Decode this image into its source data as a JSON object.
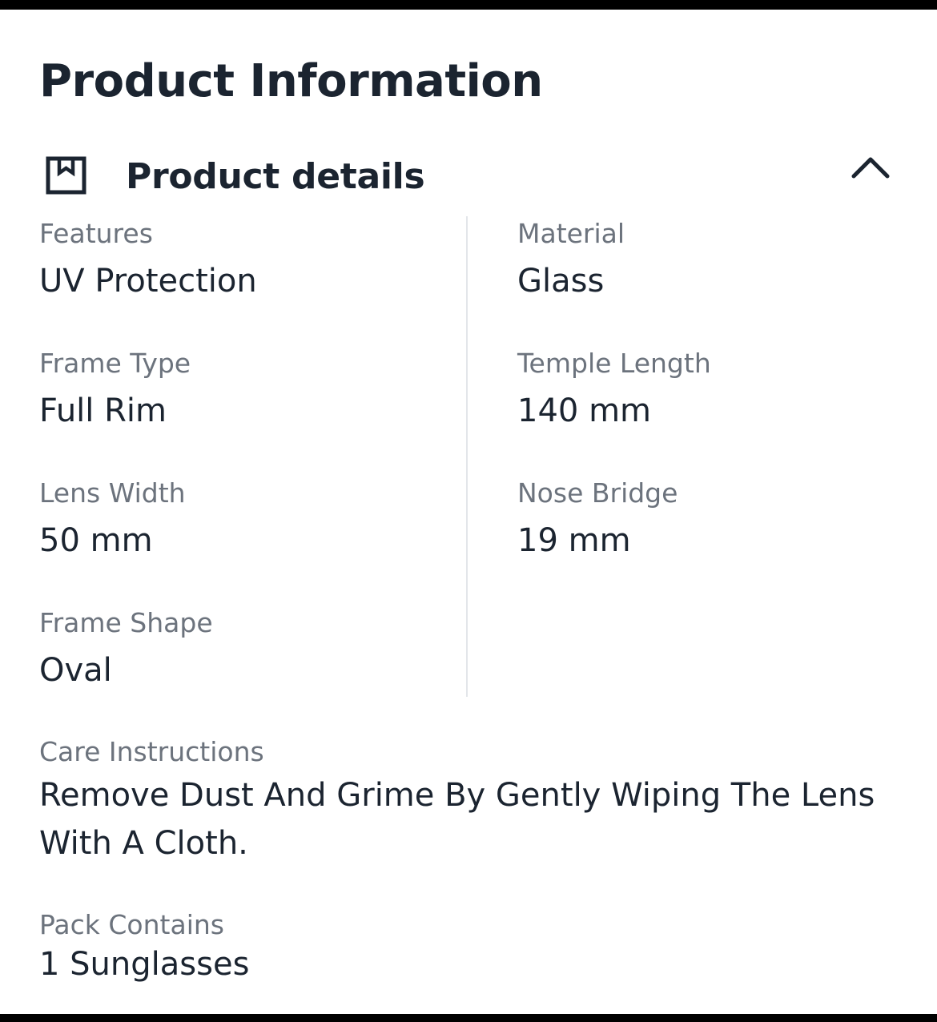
{
  "page": {
    "title": "Product Information"
  },
  "section": {
    "icon": "bookmark-box-icon",
    "title": "Product details",
    "toggle_icon": "chevron-up-icon",
    "expanded": true
  },
  "details": {
    "left": [
      {
        "label": "Features",
        "value": "UV Protection"
      },
      {
        "label": "Frame Type",
        "value": "Full Rim"
      },
      {
        "label": "Lens Width",
        "value": "50 mm"
      },
      {
        "label": "Frame Shape",
        "value": "Oval"
      }
    ],
    "right": [
      {
        "label": "Material",
        "value": "Glass"
      },
      {
        "label": "Temple Length",
        "value": "140 mm"
      },
      {
        "label": "Nose Bridge",
        "value": "19 mm"
      }
    ],
    "full": [
      {
        "label": "Care Instructions",
        "value": "Remove Dust And Grime By Gently Wiping The Lens With A Cloth."
      },
      {
        "label": "Pack Contains",
        "value": "1 Sunglasses"
      }
    ]
  },
  "colors": {
    "heading": "#1b2430",
    "label": "#6c737d",
    "divider": "#e3e6ea",
    "background": "#ffffff"
  }
}
